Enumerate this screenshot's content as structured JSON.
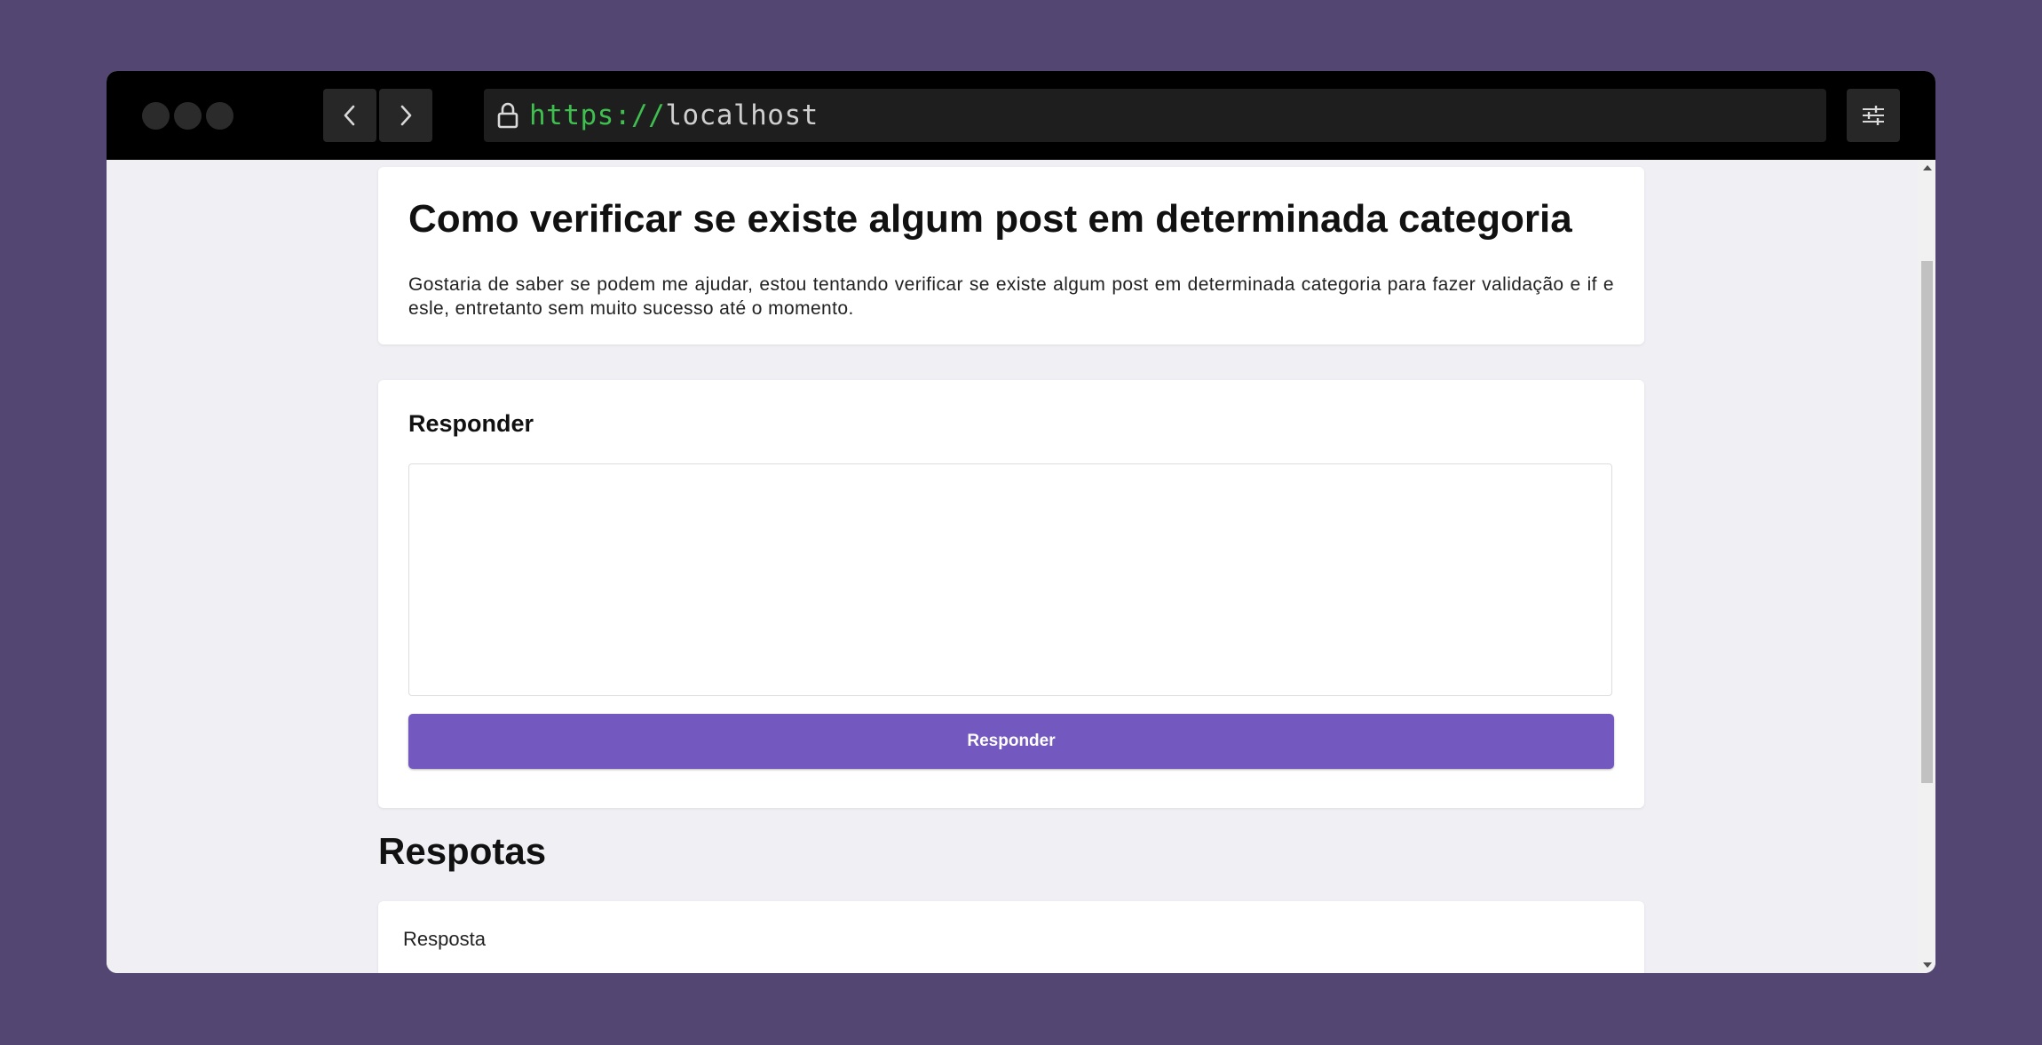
{
  "browser": {
    "url_scheme": "https://",
    "url_host": "localhost",
    "icons": {
      "back": "chevron-left-icon",
      "forward": "chevron-right-icon",
      "lock": "lock-icon",
      "settings": "sliders-icon"
    }
  },
  "post": {
    "title": "Como verificar se existe algum post em determinada categoria",
    "body": "Gostaria de saber se podem me ajudar, estou tentando verificar se existe algum post em determinada categoria para fazer validação e if e esle, entretanto sem muito sucesso até o momento."
  },
  "reply_form": {
    "title": "Responder",
    "textarea_value": "",
    "button_label": "Responder"
  },
  "answers": {
    "heading": "Respotas",
    "items": [
      {
        "text": "Resposta"
      }
    ]
  },
  "colors": {
    "background": "#544673",
    "page": "#efeff4",
    "accent": "#7358c0",
    "url_scheme": "#3fbf4f"
  }
}
